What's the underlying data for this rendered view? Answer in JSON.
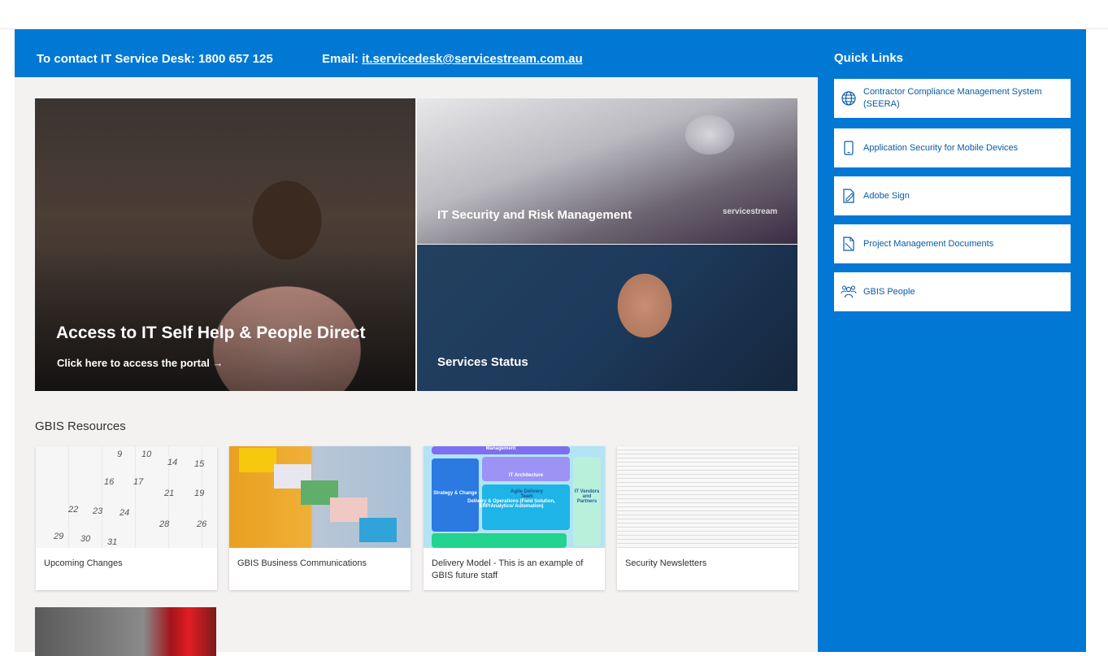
{
  "contact": {
    "phone": "To contact IT Service Desk: 1800 657 125",
    "email_label": "Email: ",
    "email": "it.servicedesk@servicestream.com.au"
  },
  "hero": {
    "main_title": "Access to IT Self Help & People Direct",
    "main_sub": "Click here to access the portal →",
    "security_title": "IT Security and Risk Management",
    "security_logo": "servicestream",
    "status_title": "Services Status"
  },
  "resources": {
    "heading": "GBIS Resources",
    "cards": [
      {
        "label": "Upcoming Changes"
      },
      {
        "label": "GBIS Business Communications"
      },
      {
        "label": "Delivery Model - This is an example of GBIS future staff"
      },
      {
        "label": "Security Newsletters"
      }
    ],
    "calendar_numbers": [
      "9",
      "10",
      "14",
      "15",
      "16",
      "17",
      "21",
      "19",
      "22",
      "23",
      "24",
      "28",
      "26",
      "29",
      "30",
      "31"
    ],
    "model_blocks": [
      "IT Architecture",
      "Strategy & Change",
      "Delivery & Operations (Field Solution, ERP/Analytics/ Automation)",
      "IT Vendors and Partners",
      "Agile Delivery Team",
      "Management"
    ]
  },
  "quick_links": {
    "title": "Quick Links",
    "items": [
      {
        "label": "Contractor Compliance Management System (SEERA)",
        "icon": "globe-icon"
      },
      {
        "label": "Application Security for Mobile Devices",
        "icon": "mobile-icon"
      },
      {
        "label": "Adobe Sign",
        "icon": "sign-document-icon"
      },
      {
        "label": "Project Management Documents",
        "icon": "document-icon"
      },
      {
        "label": "GBIS People",
        "icon": "people-icon"
      }
    ]
  },
  "colors": {
    "brand_blue": "#0078d4",
    "link_text": "#0b5aa5",
    "page_bg": "#f3f2f1"
  }
}
